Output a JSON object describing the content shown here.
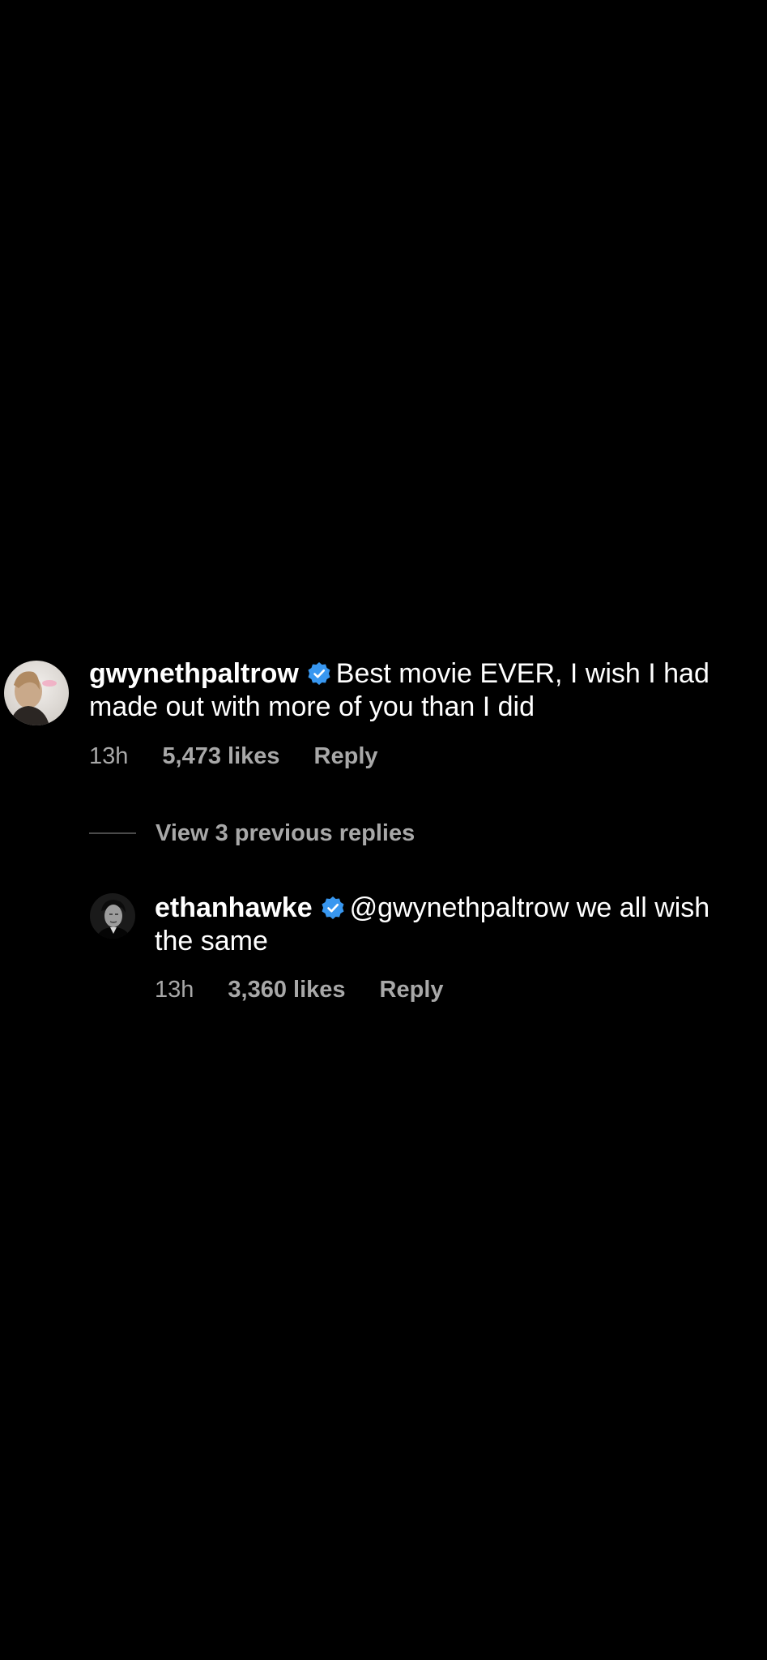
{
  "comments": [
    {
      "username": "gwynethpaltrow",
      "verified": true,
      "text": "Best movie EVER, I wish I had made out with more of you than I did",
      "time": "13h",
      "likes": "5,473 likes",
      "reply_label": "Reply"
    }
  ],
  "view_replies_label": "View 3 previous replies",
  "replies": [
    {
      "username": "ethanhawke",
      "verified": true,
      "text": "@gwynethpaltrow we all wish the same",
      "time": "13h",
      "likes": "3,360 likes",
      "reply_label": "Reply"
    }
  ],
  "colors": {
    "background": "#000000",
    "text": "#ffffff",
    "secondary_text": "#a8a8a8",
    "verified_badge": "#3897f0"
  },
  "icons": {
    "verified": "verified-badge-icon"
  }
}
